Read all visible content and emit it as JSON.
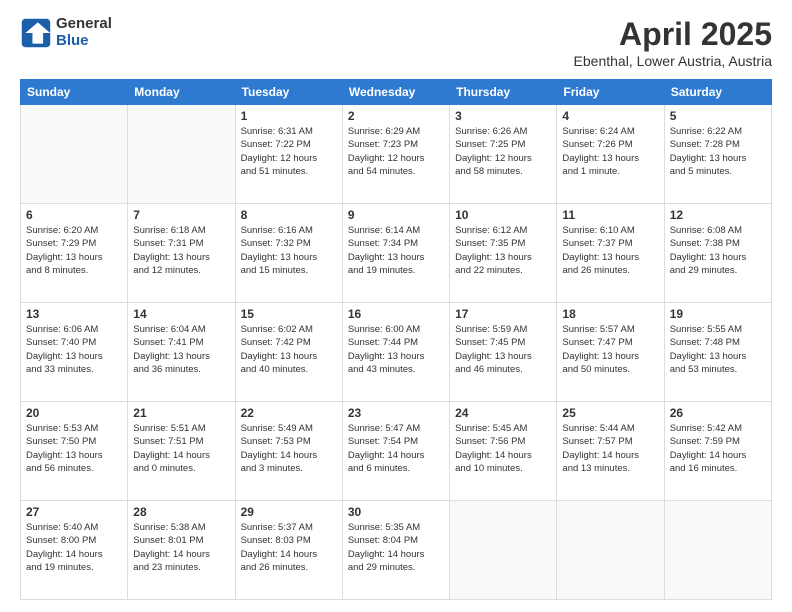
{
  "header": {
    "logo_general": "General",
    "logo_blue": "Blue",
    "title": "April 2025",
    "location": "Ebenthal, Lower Austria, Austria"
  },
  "days_of_week": [
    "Sunday",
    "Monday",
    "Tuesday",
    "Wednesday",
    "Thursday",
    "Friday",
    "Saturday"
  ],
  "weeks": [
    [
      {
        "day": "",
        "info": ""
      },
      {
        "day": "",
        "info": ""
      },
      {
        "day": "1",
        "info": "Sunrise: 6:31 AM\nSunset: 7:22 PM\nDaylight: 12 hours\nand 51 minutes."
      },
      {
        "day": "2",
        "info": "Sunrise: 6:29 AM\nSunset: 7:23 PM\nDaylight: 12 hours\nand 54 minutes."
      },
      {
        "day": "3",
        "info": "Sunrise: 6:26 AM\nSunset: 7:25 PM\nDaylight: 12 hours\nand 58 minutes."
      },
      {
        "day": "4",
        "info": "Sunrise: 6:24 AM\nSunset: 7:26 PM\nDaylight: 13 hours\nand 1 minute."
      },
      {
        "day": "5",
        "info": "Sunrise: 6:22 AM\nSunset: 7:28 PM\nDaylight: 13 hours\nand 5 minutes."
      }
    ],
    [
      {
        "day": "6",
        "info": "Sunrise: 6:20 AM\nSunset: 7:29 PM\nDaylight: 13 hours\nand 8 minutes."
      },
      {
        "day": "7",
        "info": "Sunrise: 6:18 AM\nSunset: 7:31 PM\nDaylight: 13 hours\nand 12 minutes."
      },
      {
        "day": "8",
        "info": "Sunrise: 6:16 AM\nSunset: 7:32 PM\nDaylight: 13 hours\nand 15 minutes."
      },
      {
        "day": "9",
        "info": "Sunrise: 6:14 AM\nSunset: 7:34 PM\nDaylight: 13 hours\nand 19 minutes."
      },
      {
        "day": "10",
        "info": "Sunrise: 6:12 AM\nSunset: 7:35 PM\nDaylight: 13 hours\nand 22 minutes."
      },
      {
        "day": "11",
        "info": "Sunrise: 6:10 AM\nSunset: 7:37 PM\nDaylight: 13 hours\nand 26 minutes."
      },
      {
        "day": "12",
        "info": "Sunrise: 6:08 AM\nSunset: 7:38 PM\nDaylight: 13 hours\nand 29 minutes."
      }
    ],
    [
      {
        "day": "13",
        "info": "Sunrise: 6:06 AM\nSunset: 7:40 PM\nDaylight: 13 hours\nand 33 minutes."
      },
      {
        "day": "14",
        "info": "Sunrise: 6:04 AM\nSunset: 7:41 PM\nDaylight: 13 hours\nand 36 minutes."
      },
      {
        "day": "15",
        "info": "Sunrise: 6:02 AM\nSunset: 7:42 PM\nDaylight: 13 hours\nand 40 minutes."
      },
      {
        "day": "16",
        "info": "Sunrise: 6:00 AM\nSunset: 7:44 PM\nDaylight: 13 hours\nand 43 minutes."
      },
      {
        "day": "17",
        "info": "Sunrise: 5:59 AM\nSunset: 7:45 PM\nDaylight: 13 hours\nand 46 minutes."
      },
      {
        "day": "18",
        "info": "Sunrise: 5:57 AM\nSunset: 7:47 PM\nDaylight: 13 hours\nand 50 minutes."
      },
      {
        "day": "19",
        "info": "Sunrise: 5:55 AM\nSunset: 7:48 PM\nDaylight: 13 hours\nand 53 minutes."
      }
    ],
    [
      {
        "day": "20",
        "info": "Sunrise: 5:53 AM\nSunset: 7:50 PM\nDaylight: 13 hours\nand 56 minutes."
      },
      {
        "day": "21",
        "info": "Sunrise: 5:51 AM\nSunset: 7:51 PM\nDaylight: 14 hours\nand 0 minutes."
      },
      {
        "day": "22",
        "info": "Sunrise: 5:49 AM\nSunset: 7:53 PM\nDaylight: 14 hours\nand 3 minutes."
      },
      {
        "day": "23",
        "info": "Sunrise: 5:47 AM\nSunset: 7:54 PM\nDaylight: 14 hours\nand 6 minutes."
      },
      {
        "day": "24",
        "info": "Sunrise: 5:45 AM\nSunset: 7:56 PM\nDaylight: 14 hours\nand 10 minutes."
      },
      {
        "day": "25",
        "info": "Sunrise: 5:44 AM\nSunset: 7:57 PM\nDaylight: 14 hours\nand 13 minutes."
      },
      {
        "day": "26",
        "info": "Sunrise: 5:42 AM\nSunset: 7:59 PM\nDaylight: 14 hours\nand 16 minutes."
      }
    ],
    [
      {
        "day": "27",
        "info": "Sunrise: 5:40 AM\nSunset: 8:00 PM\nDaylight: 14 hours\nand 19 minutes."
      },
      {
        "day": "28",
        "info": "Sunrise: 5:38 AM\nSunset: 8:01 PM\nDaylight: 14 hours\nand 23 minutes."
      },
      {
        "day": "29",
        "info": "Sunrise: 5:37 AM\nSunset: 8:03 PM\nDaylight: 14 hours\nand 26 minutes."
      },
      {
        "day": "30",
        "info": "Sunrise: 5:35 AM\nSunset: 8:04 PM\nDaylight: 14 hours\nand 29 minutes."
      },
      {
        "day": "",
        "info": ""
      },
      {
        "day": "",
        "info": ""
      },
      {
        "day": "",
        "info": ""
      }
    ]
  ]
}
